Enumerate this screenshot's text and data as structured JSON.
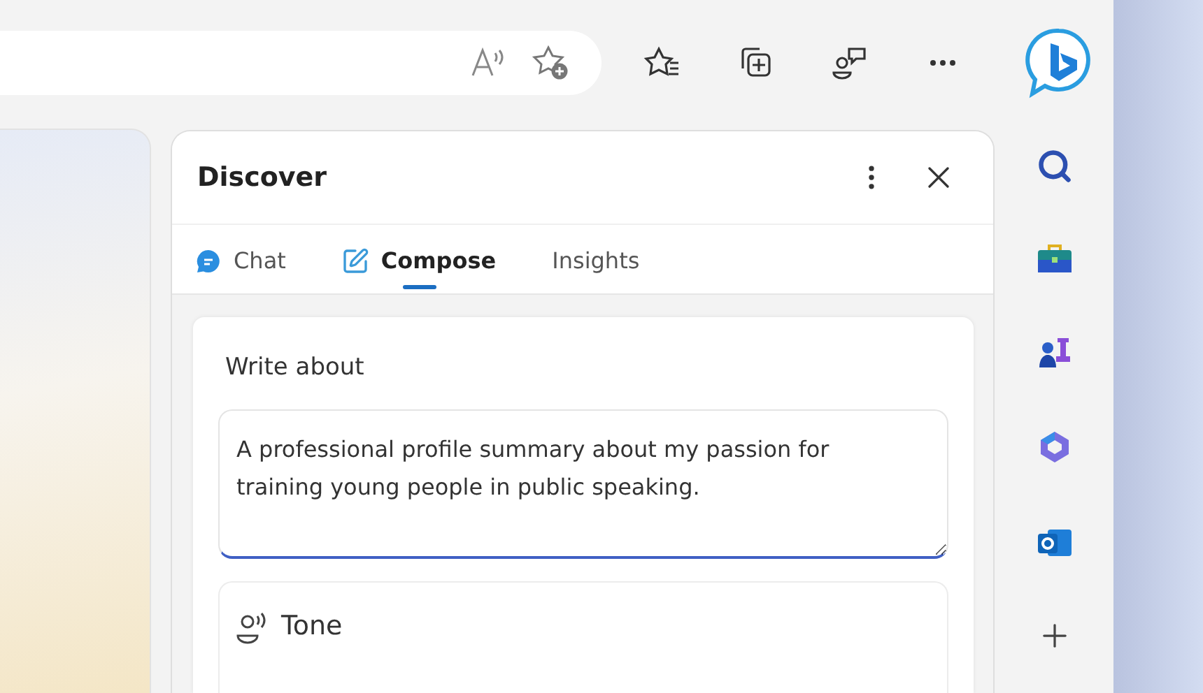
{
  "panel": {
    "title": "Discover"
  },
  "tabs": [
    {
      "label": "Chat",
      "selected": false
    },
    {
      "label": "Compose",
      "selected": true
    },
    {
      "label": "Insights",
      "selected": false
    }
  ],
  "compose": {
    "label": "Write about",
    "field": {
      "value": "A professional profile summary about my passion for training young people in public speaking.",
      "focused": true
    },
    "tone": {
      "label": "Tone"
    }
  }
}
